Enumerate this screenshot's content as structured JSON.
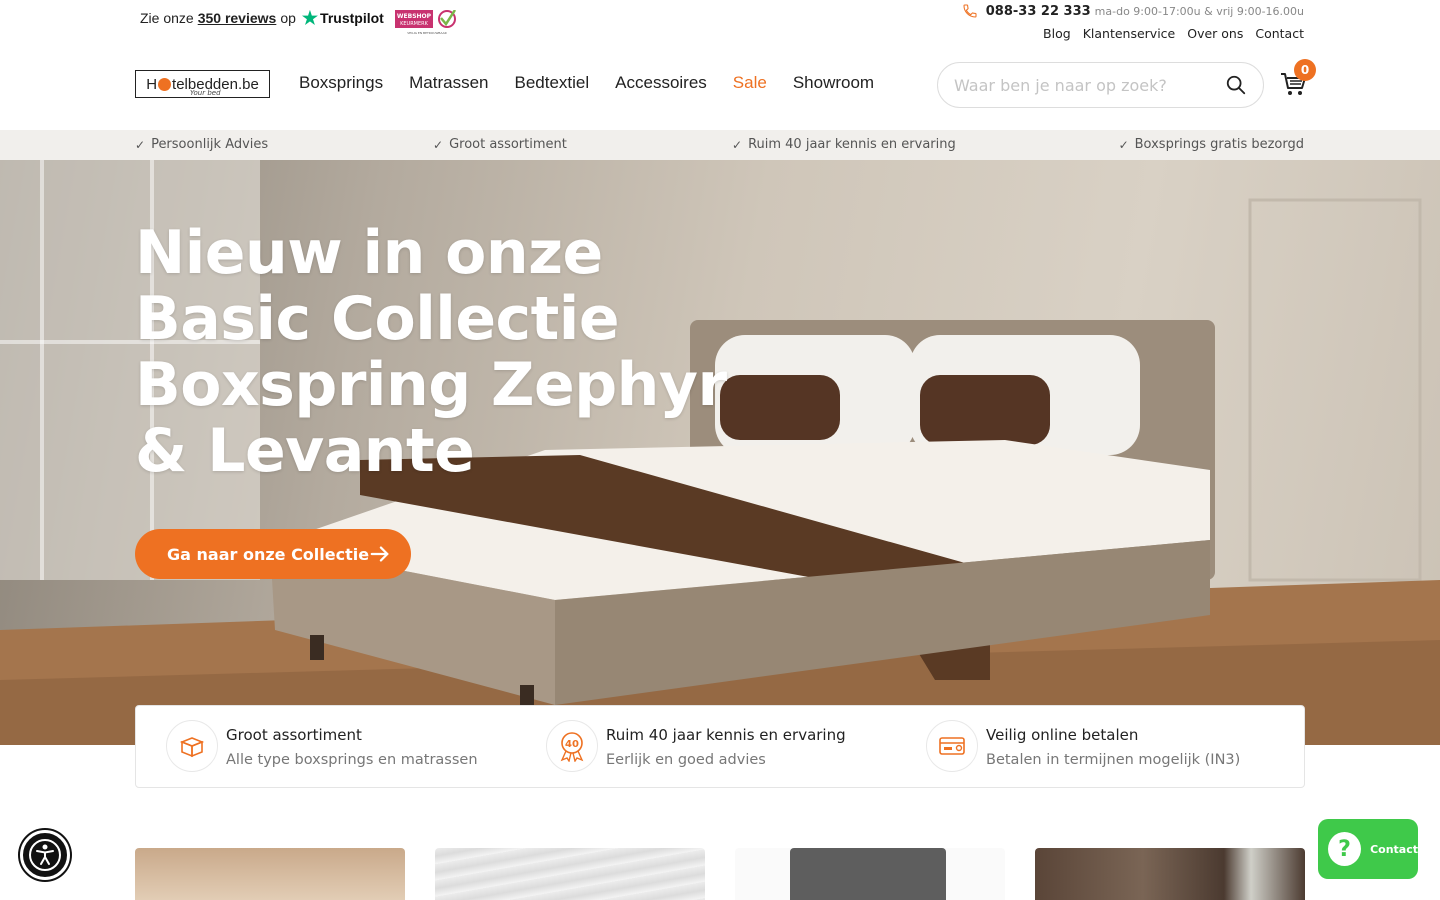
{
  "topbar": {
    "trust_prefix": "Zie onze",
    "trust_reviews": "350 reviews",
    "trust_suffix": "op",
    "trustpilot_label": "Trustpilot",
    "keurmerk_line1": "WEBSHOP",
    "keurmerk_line2": "KEURMERK",
    "keurmerk_line3": "VEILIG EN BETROUWBAAR",
    "phone": "088-33 22 333",
    "hours": "ma-do 9:00-17:00u & vrij 9:00-16.00u",
    "links": [
      "Blog",
      "Klantenservice",
      "Over ons",
      "Contact"
    ]
  },
  "header": {
    "logo_text_pre": "H",
    "logo_text_post": "telbedden.be",
    "logo_tagline": "Your bed",
    "nav": [
      "Boxsprings",
      "Matrassen",
      "Bedtextiel",
      "Accessoires",
      "Sale",
      "Showroom"
    ],
    "search_placeholder": "Waar ben je naar op zoek?",
    "cart_count": "0"
  },
  "usp": [
    "Persoonlijk Advies",
    "Groot assortiment",
    "Ruim 40 jaar kennis en ervaring",
    "Boxsprings gratis bezorgd"
  ],
  "hero": {
    "title_lines": [
      "Nieuw in onze",
      "Basic Collectie",
      "Boxspring Zephyr",
      "& Levante"
    ],
    "cta": "Ga naar onze Collectie"
  },
  "features": [
    {
      "icon": "box-icon",
      "title": "Groot assortiment",
      "subtitle": "Alle type boxsprings en matrassen"
    },
    {
      "icon": "award-40-icon",
      "title": "Ruim 40 jaar kennis en ervaring",
      "subtitle": "Eerlijk en goed advies",
      "badge": "40"
    },
    {
      "icon": "payment-card-icon",
      "title": "Veilig online betalen",
      "subtitle": "Betalen in termijnen mogelijk (IN3)"
    }
  ],
  "widgets": {
    "contact_label": "Contact",
    "accessibility_icon": "accessibility-icon"
  },
  "colors": {
    "accent": "#ee7122",
    "usp_bg": "#f1efec",
    "contact_green": "#3fc94a",
    "trustpilot_green": "#00b67a"
  }
}
